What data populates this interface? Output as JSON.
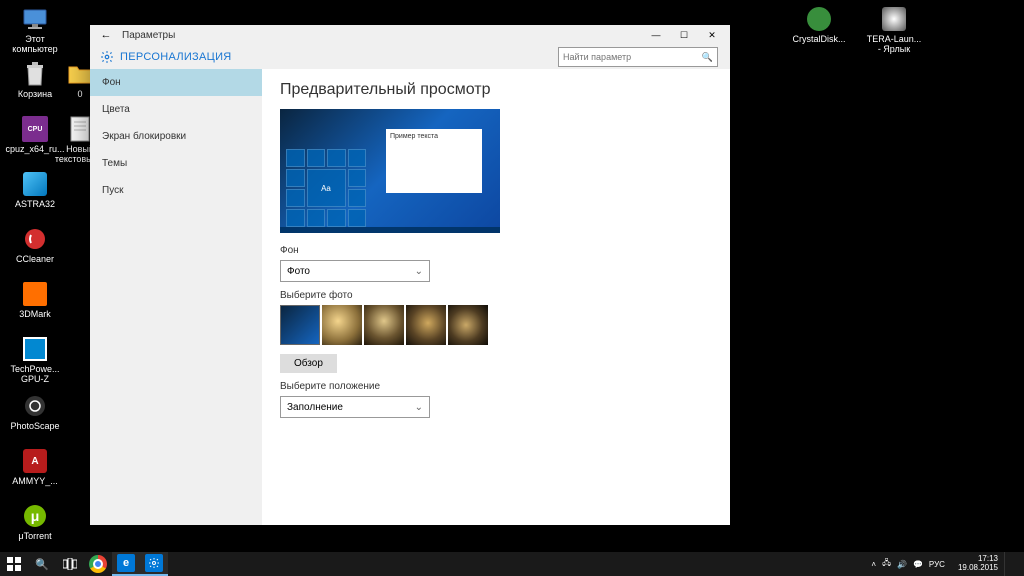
{
  "desktop_icons": {
    "col1": [
      {
        "label": "Этот компьютер"
      },
      {
        "label": "Корзина"
      },
      {
        "label": "cpuz_x64_ru..."
      },
      {
        "label": "ASTRA32"
      },
      {
        "label": "CCleaner"
      },
      {
        "label": "3DMark"
      },
      {
        "label": "TechPowe...\nGPU-Z"
      },
      {
        "label": "PhotoScape"
      },
      {
        "label": "AMMYY_..."
      },
      {
        "label": "μTorrent"
      }
    ],
    "col2": [
      {
        "label": "0"
      },
      {
        "label": "Новый текстовый..."
      }
    ],
    "right": [
      {
        "label": "CrystalDisk..."
      },
      {
        "label": "TERA-Laun... - Ярлык"
      }
    ]
  },
  "settings": {
    "app_title": "Параметры",
    "page_title": "ПЕРСОНАЛИЗАЦИЯ",
    "search_placeholder": "Найти параметр",
    "sidebar": {
      "items": [
        "Фон",
        "Цвета",
        "Экран блокировки",
        "Темы",
        "Пуск"
      ],
      "active_index": 0
    },
    "main": {
      "preview_label": "Предварительный просмотр",
      "preview_sample_text": "Пример текста",
      "preview_aa": "Aa",
      "bg_label": "Фон",
      "bg_value": "Фото",
      "choose_photo_label": "Выберите фото",
      "browse_btn": "Обзор",
      "fit_label": "Выберите положение",
      "fit_value": "Заполнение"
    }
  },
  "taskbar": {
    "lang": "РУС",
    "time": "17:13",
    "date": "19.08.2015"
  }
}
